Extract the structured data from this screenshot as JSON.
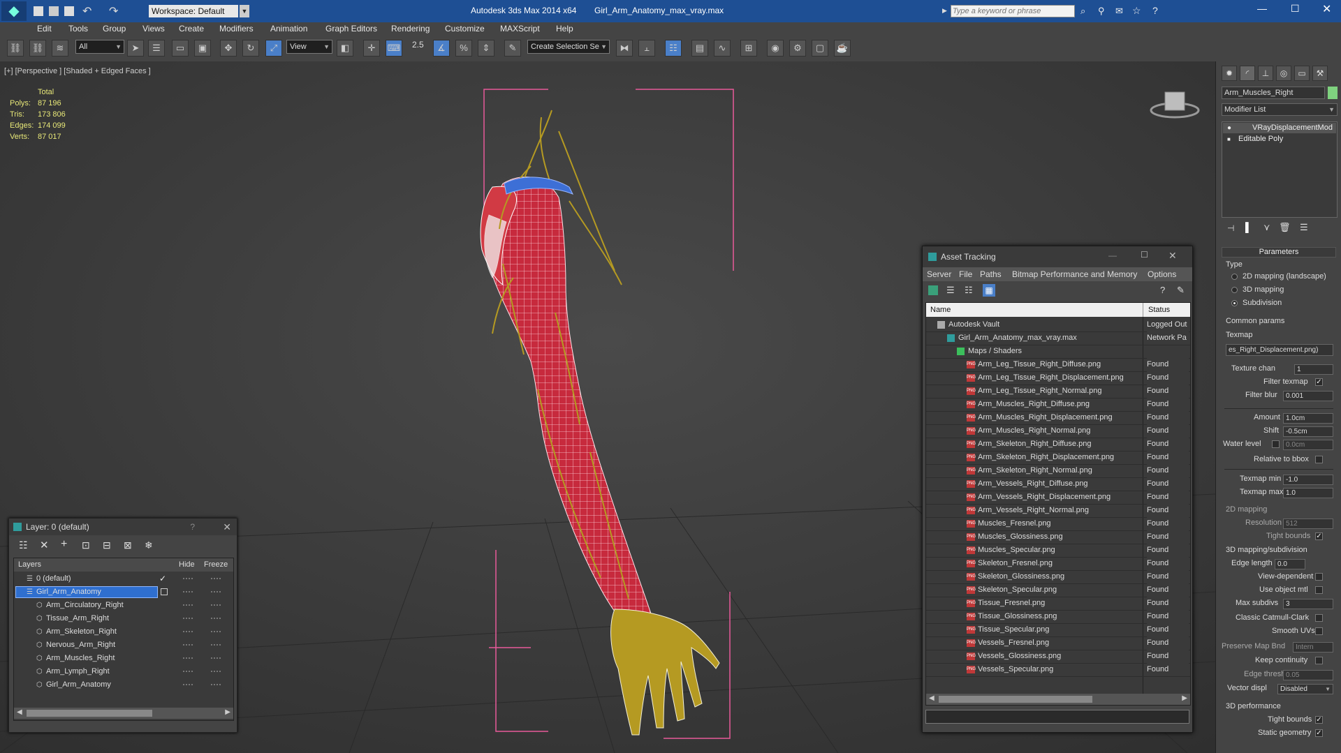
{
  "window": {
    "app_title": "Autodesk 3ds Max  2014 x64",
    "file_title": "Girl_Arm_Anatomy_max_vray.max",
    "workspace": "Workspace: Default",
    "search_placeholder": "Type a keyword or phrase"
  },
  "menu": [
    "Edit",
    "Tools",
    "Group",
    "Views",
    "Create",
    "Modifiers",
    "Animation",
    "Graph Editors",
    "Rendering",
    "Customize",
    "MAXScript",
    "Help"
  ],
  "toolbar": {
    "filter_value": "All",
    "refcoord_value": "View",
    "selection_set_placeholder": "Create Selection Se",
    "snap_label": "2.5"
  },
  "viewport": {
    "label": "[+] [Perspective ] [Shaded + Edged Faces ]",
    "stats": {
      "header": "Total",
      "rows": [
        {
          "label": "Polys:",
          "value": "87 196"
        },
        {
          "label": "Tris:",
          "value": "173 806"
        },
        {
          "label": "Edges:",
          "value": "174 099"
        },
        {
          "label": "Verts:",
          "value": "87 017"
        }
      ]
    }
  },
  "command_panel": {
    "object_name": "Arm_Muscles_Right",
    "modifier_list": "Modifier List",
    "stack": [
      "VRayDisplacementMod",
      "Editable Poly"
    ],
    "parameters_title": "Parameters",
    "type_label": "Type",
    "type_options": [
      {
        "label": "2D mapping (landscape)",
        "selected": false
      },
      {
        "label": "3D mapping",
        "selected": false
      },
      {
        "label": "Subdivision",
        "selected": true
      }
    ],
    "common_params": "Common params",
    "texmap_label": "Texmap",
    "texmap_value": "es_Right_Displacement.png)",
    "texture_chan_label": "Texture chan",
    "texture_chan_value": "1",
    "filter_texmap_label": "Filter texmap",
    "filter_blur_label": "Filter blur",
    "filter_blur_value": "0.001",
    "amount_label": "Amount",
    "amount_value": "1.0cm",
    "shift_label": "Shift",
    "shift_value": "-0.5cm",
    "water_level_label": "Water level",
    "water_level_value": "0.0cm",
    "relative_bbox_label": "Relative to bbox",
    "texmap_min_label": "Texmap min",
    "texmap_min_value": "-1.0",
    "texmap_max_label": "Texmap max",
    "texmap_max_value": "1.0",
    "mapping_2d": "2D mapping",
    "resolution_label": "Resolution",
    "resolution_value": "512",
    "tight_bounds_label": "Tight bounds",
    "mapping_3d": "3D mapping/subdivision",
    "edge_length_label": "Edge length",
    "edge_length_value": "0.0",
    "view_dependent_label": "View-dependent",
    "use_object_mtl_label": "Use object mtl",
    "max_subdivs_label": "Max subdivs",
    "max_subdivs_value": "3",
    "classic_cc_label": "Classic Catmull-Clark",
    "smooth_uvs_label": "Smooth UVs",
    "preserve_map_label": "Preserve Map Bnd",
    "preserve_map_value": "Intern",
    "keep_continuity_label": "Keep continuity",
    "edge_thresh_label": "Edge thresh",
    "edge_thresh_value": "0.05",
    "vector_displ_label": "Vector displ",
    "vector_displ_value": "Disabled",
    "perf_3d": "3D performance",
    "tight_bounds2_label": "Tight bounds",
    "static_geometry_label": "Static geometry"
  },
  "layer_window": {
    "title": "Layer: 0 (default)",
    "headers": {
      "layers": "Layers",
      "hide": "Hide",
      "freeze": "Freeze"
    },
    "rows": [
      {
        "name": "0 (default)",
        "level": 0,
        "selected": false,
        "current": true
      },
      {
        "name": "Girl_Arm_Anatomy",
        "level": 0,
        "selected": true,
        "current": false
      },
      {
        "name": "Arm_Circulatory_Right",
        "level": 1,
        "selected": false,
        "current": false
      },
      {
        "name": "Tissue_Arm_Right",
        "level": 1,
        "selected": false,
        "current": false
      },
      {
        "name": "Arm_Skeleton_Right",
        "level": 1,
        "selected": false,
        "current": false
      },
      {
        "name": "Nervous_Arm_Right",
        "level": 1,
        "selected": false,
        "current": false
      },
      {
        "name": "Arm_Muscles_Right",
        "level": 1,
        "selected": false,
        "current": false
      },
      {
        "name": "Arm_Lymph_Right",
        "level": 1,
        "selected": false,
        "current": false
      },
      {
        "name": "Girl_Arm_Anatomy",
        "level": 1,
        "selected": false,
        "current": false
      }
    ]
  },
  "asset_window": {
    "title": "Asset Tracking",
    "menu": [
      "Server",
      "File",
      "Paths",
      "Bitmap Performance and Memory",
      "Options"
    ],
    "columns": {
      "name": "Name",
      "status": "Status"
    },
    "rows": [
      {
        "name": "Autodesk Vault",
        "status": "Logged Out",
        "level": 0,
        "kind": "vault"
      },
      {
        "name": "Girl_Arm_Anatomy_max_vray.max",
        "status": "Network Pa",
        "level": 1,
        "kind": "max"
      },
      {
        "name": "Maps / Shaders",
        "status": "",
        "level": 2,
        "kind": "folder"
      },
      {
        "name": "Arm_Leg_Tissue_Right_Diffuse.png",
        "status": "Found",
        "level": 3,
        "kind": "png"
      },
      {
        "name": "Arm_Leg_Tissue_Right_Displacement.png",
        "status": "Found",
        "level": 3,
        "kind": "png"
      },
      {
        "name": "Arm_Leg_Tissue_Right_Normal.png",
        "status": "Found",
        "level": 3,
        "kind": "png"
      },
      {
        "name": "Arm_Muscles_Right_Diffuse.png",
        "status": "Found",
        "level": 3,
        "kind": "png"
      },
      {
        "name": "Arm_Muscles_Right_Displacement.png",
        "status": "Found",
        "level": 3,
        "kind": "png"
      },
      {
        "name": "Arm_Muscles_Right_Normal.png",
        "status": "Found",
        "level": 3,
        "kind": "png"
      },
      {
        "name": "Arm_Skeleton_Right_Diffuse.png",
        "status": "Found",
        "level": 3,
        "kind": "png"
      },
      {
        "name": "Arm_Skeleton_Right_Displacement.png",
        "status": "Found",
        "level": 3,
        "kind": "png"
      },
      {
        "name": "Arm_Skeleton_Right_Normal.png",
        "status": "Found",
        "level": 3,
        "kind": "png"
      },
      {
        "name": "Arm_Vessels_Right_Diffuse.png",
        "status": "Found",
        "level": 3,
        "kind": "png"
      },
      {
        "name": "Arm_Vessels_Right_Displacement.png",
        "status": "Found",
        "level": 3,
        "kind": "png"
      },
      {
        "name": "Arm_Vessels_Right_Normal.png",
        "status": "Found",
        "level": 3,
        "kind": "png"
      },
      {
        "name": "Muscles_Fresnel.png",
        "status": "Found",
        "level": 3,
        "kind": "png"
      },
      {
        "name": "Muscles_Glossiness.png",
        "status": "Found",
        "level": 3,
        "kind": "png"
      },
      {
        "name": "Muscles_Specular.png",
        "status": "Found",
        "level": 3,
        "kind": "png"
      },
      {
        "name": "Skeleton_Fresnel.png",
        "status": "Found",
        "level": 3,
        "kind": "png"
      },
      {
        "name": "Skeleton_Glossiness.png",
        "status": "Found",
        "level": 3,
        "kind": "png"
      },
      {
        "name": "Skeleton_Specular.png",
        "status": "Found",
        "level": 3,
        "kind": "png"
      },
      {
        "name": "Tissue_Fresnel.png",
        "status": "Found",
        "level": 3,
        "kind": "png"
      },
      {
        "name": "Tissue_Glossiness.png",
        "status": "Found",
        "level": 3,
        "kind": "png"
      },
      {
        "name": "Tissue_Specular.png",
        "status": "Found",
        "level": 3,
        "kind": "png"
      },
      {
        "name": "Vessels_Fresnel.png",
        "status": "Found",
        "level": 3,
        "kind": "png"
      },
      {
        "name": "Vessels_Glossiness.png",
        "status": "Found",
        "level": 3,
        "kind": "png"
      },
      {
        "name": "Vessels_Specular.png",
        "status": "Found",
        "level": 3,
        "kind": "png"
      }
    ]
  },
  "colors": {
    "titlebar": "#1e4f94",
    "selection": "#2f6fcf",
    "wire_red": "#e0334a",
    "nerve_yellow": "#b59a22",
    "bbox_pink": "#e85a9a",
    "stats_yellow": "#e8e878"
  }
}
